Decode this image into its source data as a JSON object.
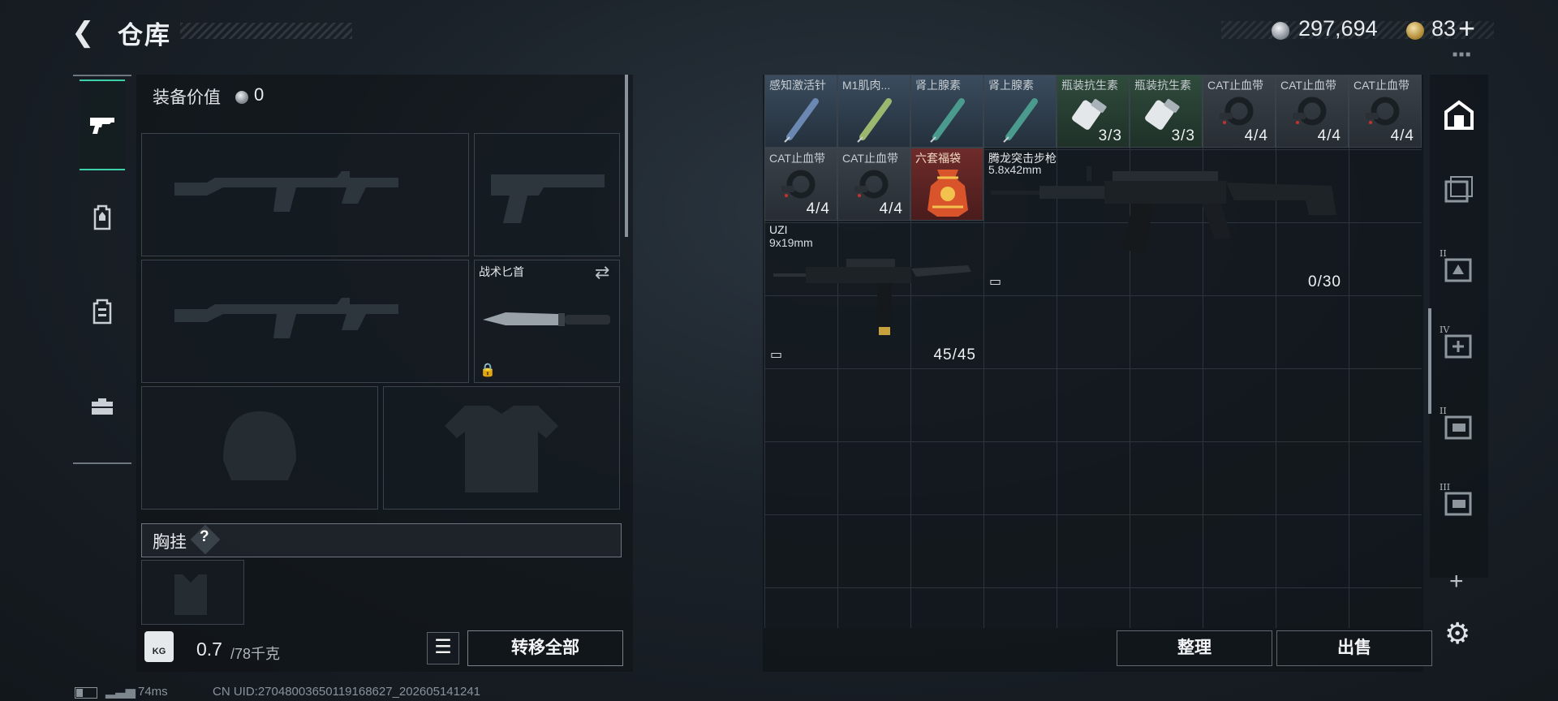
{
  "header": {
    "title": "仓库",
    "currency_silver": "297,694",
    "currency_gold": "83"
  },
  "left_tabs": [
    {
      "name": "pistol-icon",
      "active": true
    },
    {
      "name": "backpack-icon",
      "active": false
    },
    {
      "name": "vest-icon",
      "active": false
    },
    {
      "name": "toolbox-icon",
      "active": false
    }
  ],
  "equipment": {
    "value_label": "装备价值",
    "value": "0",
    "knife_label": "战术匕首",
    "chest_label": "胸挂",
    "chest_help": "?",
    "weight_icon": "KG",
    "weight_current": "0.7",
    "weight_capacity": "/78千克",
    "transfer_all": "转移全部"
  },
  "stash": {
    "items": [
      {
        "name": "感知激活针",
        "color": "blue"
      },
      {
        "name": "M1肌肉...",
        "color": "blue"
      },
      {
        "name": "肾上腺素",
        "color": "blue"
      },
      {
        "name": "肾上腺素",
        "color": "blue"
      },
      {
        "name": "瓶装抗生素",
        "count": "3/3",
        "color": "green"
      },
      {
        "name": "瓶装抗生素",
        "count": "3/3",
        "color": "green"
      },
      {
        "name": "CAT止血带",
        "count": "4/4",
        "color": "gray"
      },
      {
        "name": "CAT止血带",
        "count": "4/4",
        "color": "gray"
      },
      {
        "name": "CAT止血带",
        "count": "4/4",
        "color": "gray"
      },
      {
        "name": "CAT止血带",
        "count": "4/4",
        "color": "gray"
      },
      {
        "name": "CAT止血带",
        "count": "4/4",
        "color": "gray"
      },
      {
        "name": "六套福袋",
        "color": "red"
      },
      {
        "name": "腾龙突击步枪",
        "sub": "5.8x42mm",
        "count": "0/30"
      },
      {
        "name": "UZI",
        "sub": "9x19mm",
        "count": "45/45"
      }
    ],
    "sort_label": "整理",
    "sell_label": "出售"
  },
  "right_tabs": [
    {
      "name": "stash-icon",
      "active": true
    },
    {
      "name": "stash-page-1-icon",
      "numeral": ""
    },
    {
      "name": "stash-page-2-icon",
      "numeral": "II"
    },
    {
      "name": "stash-page-4-icon",
      "numeral": "IV"
    },
    {
      "name": "stash-page-5-icon",
      "numeral": "II"
    },
    {
      "name": "stash-page-6-icon",
      "numeral": "III"
    }
  ],
  "status": {
    "ping": "74ms",
    "uid": "CN UID:2704800365011916862​7_202605141241"
  },
  "colors": {
    "accent": "#3cd1a8",
    "blue_item": "#3a4c5e",
    "green_item": "#2f4b3c",
    "red_item": "#6e2b2a"
  }
}
